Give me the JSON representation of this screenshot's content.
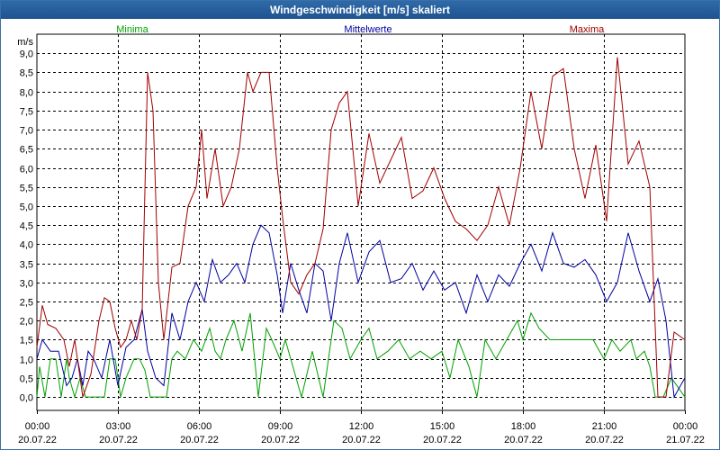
{
  "window": {
    "title": "Windgeschwindigkeit [m/s] skaliert"
  },
  "chart_data": {
    "type": "line",
    "title": "Windgeschwindigkeit [m/s] skaliert",
    "ylabel": "m/s",
    "xlabel": "",
    "ylim": [
      -0.35,
      9.5
    ],
    "xlim": [
      0,
      24
    ],
    "grid": true,
    "legend_placement": "top",
    "y_ticks": [
      "0,0",
      "0,5",
      "1,0",
      "1,5",
      "2,0",
      "2,5",
      "3,0",
      "3,5",
      "4,0",
      "4,5",
      "5,0",
      "5,5",
      "6,0",
      "6,5",
      "7,0",
      "7,5",
      "8,0",
      "8,5",
      "9,0"
    ],
    "y_tick_values": [
      0,
      0.5,
      1,
      1.5,
      2,
      2.5,
      3,
      3.5,
      4,
      4.5,
      5,
      5.5,
      6,
      6.5,
      7,
      7.5,
      8,
      8.5,
      9
    ],
    "x_ticks": [
      {
        "time": "00:00",
        "date": "20.07.22"
      },
      {
        "time": "03:00",
        "date": "20.07.22"
      },
      {
        "time": "06:00",
        "date": "20.07.22"
      },
      {
        "time": "09:00",
        "date": "20.07.22"
      },
      {
        "time": "12:00",
        "date": "20.07.22"
      },
      {
        "time": "15:00",
        "date": "20.07.22"
      },
      {
        "time": "18:00",
        "date": "20.07.22"
      },
      {
        "time": "21:00",
        "date": "20.07.22"
      },
      {
        "time": "00:00",
        "date": "21.07.22"
      }
    ],
    "x_tick_values": [
      0,
      3,
      6,
      9,
      12,
      15,
      18,
      21,
      24
    ],
    "series": [
      {
        "name": "Minima",
        "color": "#00a000",
        "x": [
          0,
          0.1,
          0.3,
          0.5,
          0.7,
          0.9,
          1.1,
          1.2,
          1.4,
          1.6,
          1.8,
          2,
          2.2,
          2.5,
          2.7,
          2.9,
          3.1,
          3.3,
          3.6,
          3.8,
          4,
          4.2,
          4.5,
          4.8,
          5,
          5.2,
          5.5,
          5.8,
          6.1,
          6.4,
          6.6,
          6.8,
          7,
          7.3,
          7.6,
          7.9,
          8.2,
          8.5,
          8.7,
          9,
          9.2,
          9.4,
          9.8,
          10.2,
          10.6,
          11,
          11.3,
          11.6,
          12,
          12.3,
          12.6,
          13,
          13.4,
          13.8,
          14.2,
          14.6,
          15,
          15.3,
          15.6,
          16,
          16.3,
          16.6,
          17,
          17.4,
          17.8,
          18,
          18.3,
          18.6,
          19,
          19.4,
          19.8,
          20.2,
          20.6,
          21,
          21.3,
          21.6,
          22,
          22.2,
          22.5,
          22.7,
          22.9,
          23.2,
          23.5,
          24
        ],
        "values": [
          0,
          0.8,
          0,
          1,
          1,
          0,
          1,
          0.5,
          0,
          0.5,
          0,
          0,
          0,
          0,
          1,
          1,
          0,
          0.5,
          1,
          1,
          0.7,
          0,
          0,
          0,
          1,
          1.2,
          1,
          1.5,
          1.2,
          1.8,
          1.2,
          1,
          1.5,
          2,
          1.2,
          2.2,
          0,
          1.8,
          1.5,
          1,
          1.5,
          1,
          0,
          1.2,
          0,
          2,
          1.8,
          1,
          1.5,
          1.8,
          1,
          1.2,
          1.5,
          1,
          1.2,
          1,
          1.2,
          0.5,
          1.5,
          0.8,
          0,
          1.5,
          1,
          1.5,
          2,
          1.5,
          2.2,
          1.8,
          1.5,
          1.5,
          1.5,
          1.5,
          1.5,
          1,
          1.5,
          1.2,
          1.5,
          1,
          1.2,
          0.8,
          0,
          0,
          0.5,
          0
        ]
      },
      {
        "name": "Mittelwerte",
        "color": "#0000a0",
        "x": [
          0,
          0.2,
          0.5,
          0.8,
          1.1,
          1.3,
          1.5,
          1.7,
          1.9,
          2.1,
          2.4,
          2.7,
          3,
          3.3,
          3.6,
          3.9,
          4.1,
          4.4,
          4.7,
          5,
          5.3,
          5.6,
          5.9,
          6.2,
          6.5,
          6.8,
          7.1,
          7.4,
          7.7,
          8,
          8.3,
          8.6,
          8.9,
          9.1,
          9.4,
          9.7,
          10,
          10.3,
          10.6,
          10.9,
          11.2,
          11.5,
          11.9,
          12.3,
          12.7,
          13.1,
          13.5,
          13.9,
          14.3,
          14.7,
          15.1,
          15.5,
          15.9,
          16.3,
          16.7,
          17.1,
          17.5,
          17.9,
          18.3,
          18.7,
          19.1,
          19.5,
          19.9,
          20.3,
          20.7,
          21.1,
          21.5,
          21.9,
          22.3,
          22.7,
          23,
          23.3,
          23.6,
          24
        ],
        "values": [
          1,
          1.5,
          1.2,
          1.2,
          0.3,
          0.5,
          1,
          0.3,
          1.2,
          1,
          0.5,
          1.5,
          0.3,
          1.3,
          1.5,
          2.3,
          1.2,
          0.5,
          0.3,
          2.2,
          1.5,
          2.5,
          3,
          2.5,
          3.6,
          3,
          3.2,
          3.5,
          3,
          4,
          4.5,
          4.3,
          3.2,
          2.2,
          3.5,
          2.8,
          2.2,
          3.5,
          3.3,
          2,
          3.5,
          4.3,
          3,
          3.8,
          4.1,
          3,
          3.1,
          3.5,
          2.8,
          3.3,
          2.8,
          3,
          2.2,
          3.2,
          2.5,
          3.2,
          2.9,
          3.5,
          4,
          3.3,
          4.3,
          3.5,
          3.4,
          3.6,
          3.2,
          2.5,
          3,
          4.3,
          3.3,
          2.5,
          3.1,
          2,
          0,
          0.5
        ]
      },
      {
        "name": "Maxima",
        "color": "#a00000",
        "x": [
          0,
          0.2,
          0.4,
          0.7,
          1,
          1.2,
          1.4,
          1.7,
          2,
          2.3,
          2.5,
          2.7,
          2.9,
          3.1,
          3.3,
          3.5,
          3.7,
          3.9,
          4.1,
          4.3,
          4.5,
          4.7,
          5,
          5.3,
          5.6,
          5.9,
          6.1,
          6.3,
          6.6,
          6.9,
          7.2,
          7.5,
          7.8,
          8,
          8.3,
          8.6,
          8.9,
          9.1,
          9.4,
          9.7,
          10,
          10.3,
          10.6,
          10.9,
          11.2,
          11.5,
          11.9,
          12.3,
          12.7,
          13.1,
          13.5,
          13.9,
          14.3,
          14.7,
          15.1,
          15.5,
          15.9,
          16.3,
          16.7,
          17.1,
          17.5,
          17.9,
          18.3,
          18.7,
          19.1,
          19.5,
          19.9,
          20.3,
          20.7,
          21.1,
          21.5,
          21.9,
          22.3,
          22.7,
          23,
          23.3,
          23.6,
          24
        ],
        "values": [
          1.3,
          2.4,
          1.9,
          1.8,
          1.5,
          0.8,
          1.5,
          0,
          0.6,
          2,
          2.6,
          2.5,
          1.8,
          1.3,
          1.5,
          2,
          1.5,
          2.3,
          8.5,
          7.5,
          3,
          1.5,
          3.4,
          3.5,
          5,
          5.5,
          7,
          5.2,
          6.5,
          5,
          5.5,
          6.5,
          8.5,
          8,
          8.5,
          8.5,
          6,
          4.7,
          3,
          2.7,
          3.2,
          3.5,
          4.4,
          7,
          7.7,
          8,
          5,
          6.9,
          5.6,
          6.2,
          6.8,
          5.2,
          5.4,
          6,
          5.2,
          4.6,
          4.4,
          4.1,
          4.5,
          5.5,
          4.5,
          6,
          8,
          6.5,
          8.4,
          8.6,
          6.5,
          5.2,
          6.6,
          4.6,
          8.9,
          6.1,
          6.7,
          5.5,
          0,
          0,
          1.7,
          1.5
        ]
      }
    ]
  }
}
